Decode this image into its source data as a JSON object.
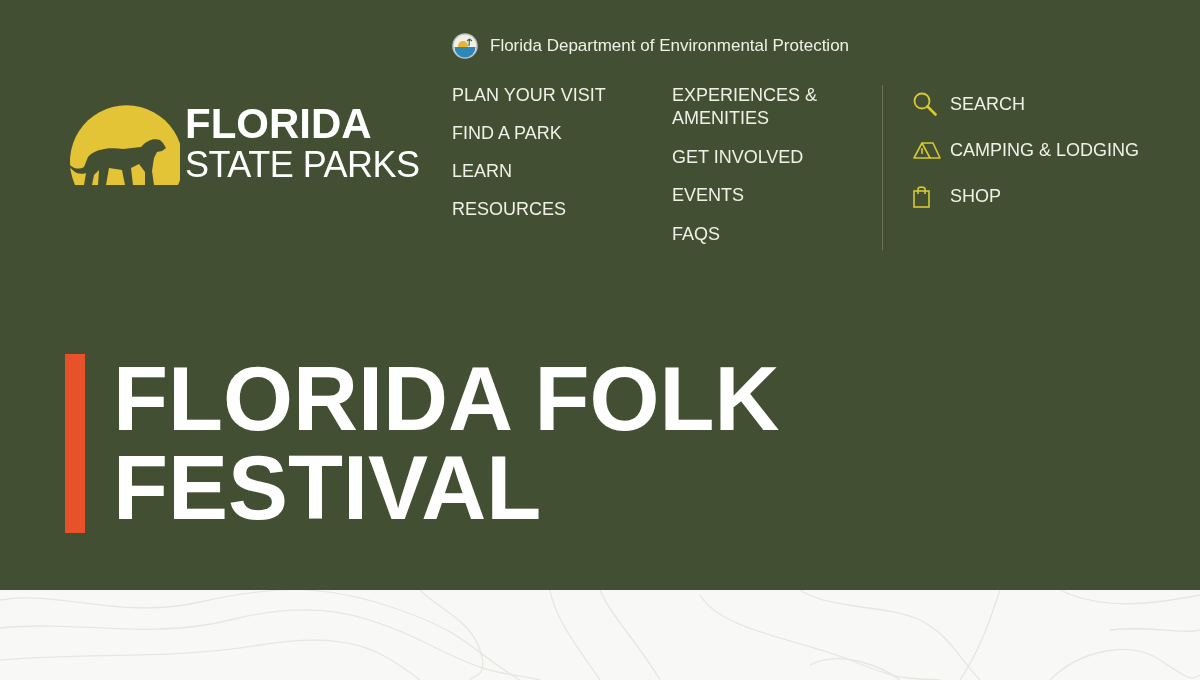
{
  "agency": {
    "name": "Florida Department of Environmental Protection"
  },
  "logo": {
    "line_1": "FLORIDA",
    "line_2": "STATE PARKS"
  },
  "nav": {
    "column_1": [
      "PLAN YOUR VISIT",
      "FIND A PARK",
      "LEARN",
      "RESOURCES"
    ],
    "column_2": [
      "EXPERIENCES & AMENITIES",
      "GET INVOLVED",
      "EVENTS",
      "FAQS"
    ]
  },
  "utility_links": [
    {
      "label": "SEARCH",
      "kind": "search"
    },
    {
      "label": "CAMPING & LODGING",
      "kind": "camping"
    },
    {
      "label": "SHOP",
      "kind": "shop"
    }
  ],
  "hero": {
    "title": "FLORIDA FOLK FESTIVAL"
  }
}
